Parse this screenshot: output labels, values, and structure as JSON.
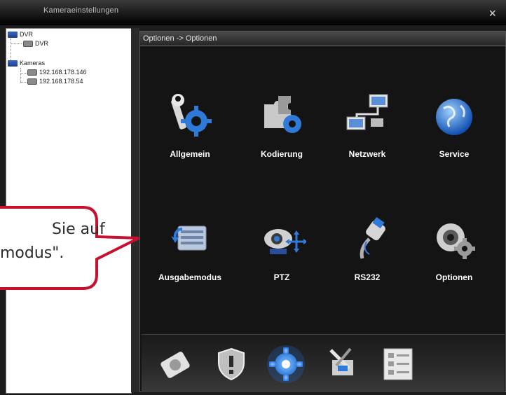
{
  "window": {
    "title": "Kameraeinstellungen",
    "close_glyph": "×"
  },
  "tree": {
    "root": "DVR",
    "dvr_child": "DVR",
    "cameras": "Kameras",
    "cam1": "192.168.178.146",
    "cam2": "192.168.178.54"
  },
  "panel": {
    "breadcrumb": "Optionen -> Optionen"
  },
  "items": [
    {
      "label": "Allgemein",
      "icon": "wrench-gear-icon"
    },
    {
      "label": "Kodierung",
      "icon": "puzzle-gear-icon"
    },
    {
      "label": "Netzwerk",
      "icon": "network-icon"
    },
    {
      "label": "Service",
      "icon": "globe-icon"
    },
    {
      "label": "Ausgabemodus",
      "icon": "display-output-icon"
    },
    {
      "label": "PTZ",
      "icon": "ptz-camera-icon"
    },
    {
      "label": "RS232",
      "icon": "rs232-cable-icon"
    },
    {
      "label": "Optionen",
      "icon": "camera-gear-icon"
    }
  ],
  "dock": [
    "disk-icon",
    "shield-warning-icon",
    "gear-icon",
    "tools-icon",
    "checklist-icon"
  ],
  "callout": {
    "line1": "Sie auf",
    "line2": "modus\"."
  },
  "colors": {
    "accent": "#1e6fd6",
    "callout_border": "#c8102e"
  }
}
